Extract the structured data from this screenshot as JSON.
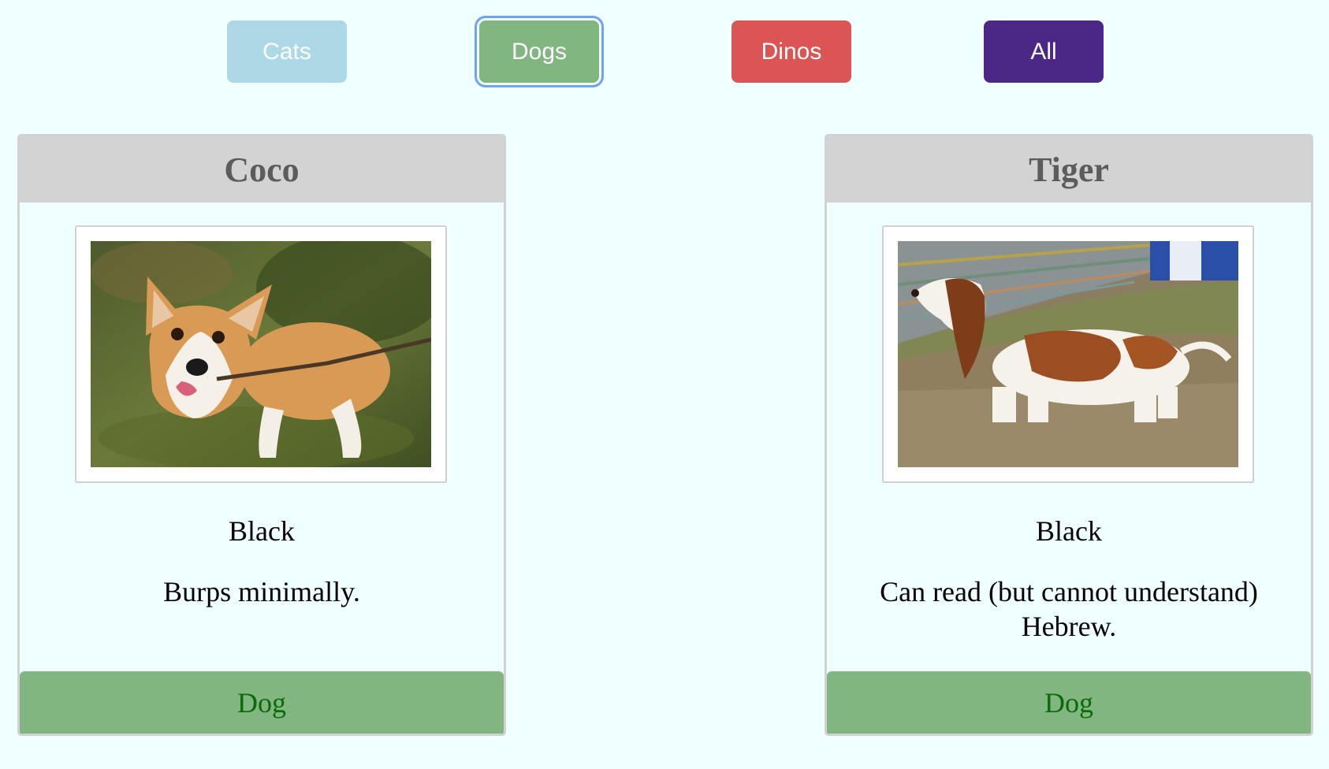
{
  "filters": [
    {
      "label": "Cats",
      "color": "#add8e6"
    },
    {
      "label": "Dogs",
      "color": "#82b680"
    },
    {
      "label": "Dinos",
      "color": "#dc5555"
    },
    {
      "label": "All",
      "color": "#4b2885"
    }
  ],
  "selected_filter": "Dogs",
  "cards": [
    {
      "name": "Coco",
      "photo_icon": "corgi-photo",
      "color": "Black",
      "description": "Burps minimally.",
      "type": "Dog"
    },
    {
      "name": "Tiger",
      "photo_icon": "basset-hound-photo",
      "color": "Black",
      "description": "Can read (but cannot understand) Hebrew.",
      "type": "Dog"
    }
  ]
}
